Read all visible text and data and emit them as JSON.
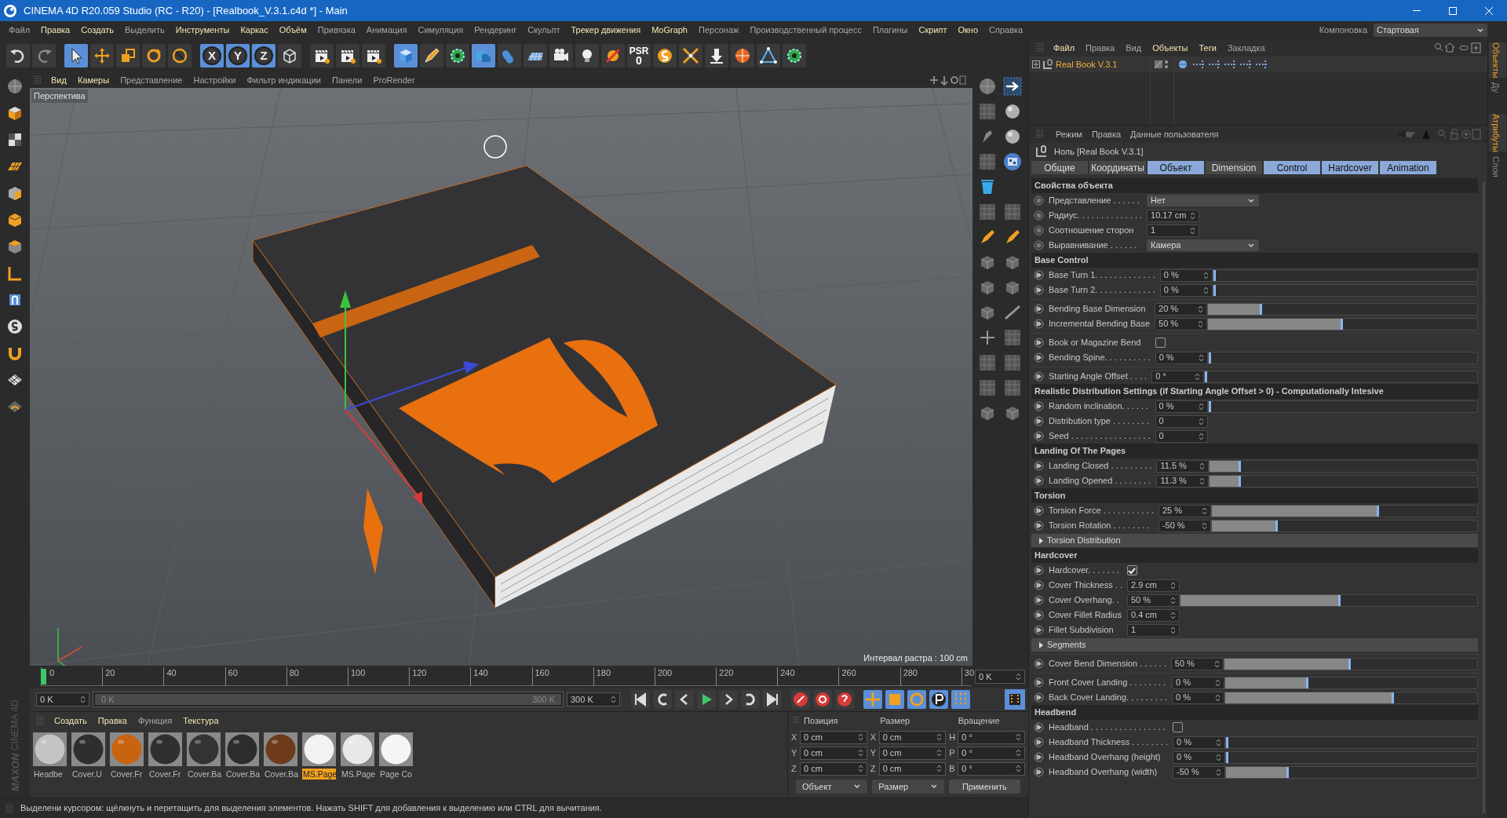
{
  "window": {
    "title": "CINEMA 4D R20.059 Studio (RC - R20) - [Realbook_V.3.1.c4d *] - Main"
  },
  "menu_bar": {
    "items": [
      {
        "label": "Файл",
        "highlighted": false
      },
      {
        "label": "Правка",
        "highlighted": true
      },
      {
        "label": "Создать",
        "highlighted": true
      },
      {
        "label": "Выделить",
        "highlighted": false
      },
      {
        "label": "Инструменты",
        "highlighted": true
      },
      {
        "label": "Каркас",
        "highlighted": true
      },
      {
        "label": "Объём",
        "highlighted": true
      },
      {
        "label": "Привязка",
        "highlighted": false
      },
      {
        "label": "Анимация",
        "highlighted": false
      },
      {
        "label": "Симуляция",
        "highlighted": false
      },
      {
        "label": "Рендеринг",
        "highlighted": false
      },
      {
        "label": "Скульпт",
        "highlighted": false
      },
      {
        "label": "Трекер движения",
        "highlighted": true
      },
      {
        "label": "MoGraph",
        "highlighted": true
      },
      {
        "label": "Персонаж",
        "highlighted": false
      },
      {
        "label": "Производственный процесс",
        "highlighted": false
      },
      {
        "label": "Плагины",
        "highlighted": false
      },
      {
        "label": "Скрипт",
        "highlighted": true
      },
      {
        "label": "Окно",
        "highlighted": true
      },
      {
        "label": "Справка",
        "highlighted": false
      }
    ],
    "layout_label": "Компоновка",
    "layout_value": "Стартовая"
  },
  "toolbar": {
    "tools": [
      {
        "kind": "undo",
        "active": false
      },
      {
        "kind": "redo",
        "active": false
      },
      {
        "kind": "cursor",
        "active": true
      },
      {
        "kind": "move",
        "active": false
      },
      {
        "kind": "scale",
        "active": false
      },
      {
        "kind": "rotate",
        "active": false
      },
      {
        "kind": "target",
        "active": false
      },
      {
        "kind": "axis",
        "label": "X",
        "active": true
      },
      {
        "kind": "axis",
        "label": "Y",
        "active": true
      },
      {
        "kind": "axis",
        "label": "Z",
        "active": true
      },
      {
        "kind": "coord",
        "active": false
      },
      {
        "kind": "clapper",
        "active": false
      },
      {
        "kind": "clapper",
        "active": false
      },
      {
        "kind": "clapper",
        "active": false
      },
      {
        "kind": "cube",
        "active": true
      },
      {
        "kind": "pen",
        "active": false
      },
      {
        "kind": "gear",
        "active": false
      },
      {
        "kind": "deformer",
        "active": true
      },
      {
        "kind": "capsule",
        "active": false
      },
      {
        "kind": "floor",
        "active": false
      },
      {
        "kind": "camera",
        "active": false
      },
      {
        "kind": "bulb",
        "active": false
      },
      {
        "kind": "tag",
        "active": false
      },
      {
        "kind": "psr",
        "label": "PSR",
        "value": "0",
        "active": false
      },
      {
        "kind": "spiral",
        "active": false
      },
      {
        "kind": "arrows",
        "active": false
      },
      {
        "kind": "download",
        "active": false
      },
      {
        "kind": "sphere",
        "active": false
      },
      {
        "kind": "triangle",
        "active": false
      },
      {
        "kind": "gear",
        "active": false
      }
    ]
  },
  "viewport": {
    "menu": [
      {
        "label": "Вид",
        "highlighted": true
      },
      {
        "label": "Камеры",
        "highlighted": true
      },
      {
        "label": "Представление",
        "highlighted": false
      },
      {
        "label": "Настройки",
        "highlighted": false
      },
      {
        "label": "Фильтр индикации",
        "highlighted": false
      },
      {
        "label": "Панели",
        "highlighted": false
      },
      {
        "label": "ProRender",
        "highlighted": false
      }
    ],
    "camera_label": "Перспектива",
    "grid_label": "Интервал растра : 100 cm"
  },
  "timeline": {
    "ticks": [
      "0",
      "20",
      "40",
      "60",
      "80",
      "100",
      "120",
      "140",
      "160",
      "180",
      "200",
      "220",
      "240",
      "260",
      "280",
      "30"
    ],
    "current_frame": "0 K",
    "start": "0 K",
    "range": {
      "start": "0 K",
      "end": "300 K",
      "level": 1
    },
    "end": "300 K"
  },
  "material_manager": {
    "menu": [
      {
        "label": "Создать",
        "highlighted": true
      },
      {
        "label": "Правка",
        "highlighted": true
      },
      {
        "label": "Функция",
        "highlighted": false
      },
      {
        "label": "Текстура",
        "highlighted": true
      }
    ],
    "materials": [
      {
        "name": "Headbe",
        "color": "#c4c4c4",
        "selected": false
      },
      {
        "name": "Cover.U",
        "color": "#2e2e2e",
        "selected": false
      },
      {
        "name": "Cover.Fr",
        "color": "#c8640f",
        "selected": false
      },
      {
        "name": "Cover.Fr",
        "color": "#303030",
        "selected": false
      },
      {
        "name": "Cover.Ba",
        "color": "#333333",
        "selected": false
      },
      {
        "name": "Cover.Ba",
        "color": "#2c2c2c",
        "selected": false
      },
      {
        "name": "Cover.Ba",
        "color": "#6e3a1c",
        "selected": false
      },
      {
        "name": "MS.Page",
        "color": "#f2f2f2",
        "selected": true
      },
      {
        "name": "MS.Page",
        "color": "#e8e8e8",
        "selected": false
      },
      {
        "name": "Page Co",
        "color": "#f5f5f5",
        "selected": false
      }
    ]
  },
  "coordinates": {
    "headers": [
      "Позиция",
      "Размер",
      "Вращение"
    ],
    "rows": [
      {
        "fields": [
          {
            "axis": "X",
            "value": "0 cm"
          },
          {
            "axis": "X",
            "value": "0 cm"
          },
          {
            "axis": "H",
            "value": "0 °"
          }
        ]
      },
      {
        "fields": [
          {
            "axis": "Y",
            "value": "0 cm"
          },
          {
            "axis": "Y",
            "value": "0 cm"
          },
          {
            "axis": "P",
            "value": "0 °"
          }
        ]
      },
      {
        "fields": [
          {
            "axis": "Z",
            "value": "0 cm"
          },
          {
            "axis": "Z",
            "value": "0 cm"
          },
          {
            "axis": "B",
            "value": "0 °"
          }
        ]
      }
    ],
    "dropdowns": [
      "Объект",
      "Размер"
    ],
    "apply_button": "Применить"
  },
  "logo": {
    "lines": [
      "MAXON",
      "CINEMA 4D"
    ]
  },
  "status_bar": "Выделени курсором: щёлкнуть и перетащить для выделения элементов. Нажать SHIFT для добавления к выделению или CTRL для вычитания.",
  "object_manager": {
    "menu": [
      {
        "label": "Файл",
        "highlighted": true
      },
      {
        "label": "Правка",
        "highlighted": false
      },
      {
        "label": "Вид",
        "highlighted": false
      },
      {
        "label": "Объекты",
        "highlighted": true
      },
      {
        "label": "Теги",
        "highlighted": true
      },
      {
        "label": "Закладка",
        "highlighted": false
      }
    ],
    "objects": [
      {
        "name": "Real Book V.3.1"
      }
    ]
  },
  "side_tabs": [
    {
      "label": "Объекты",
      "selected": true
    },
    {
      "label": "Ду",
      "selected": false
    },
    {
      "label": "Атрибуты",
      "selected": true
    },
    {
      "label": "Слои",
      "selected": false
    }
  ],
  "attributes": {
    "menu": [
      "Режим",
      "Правка",
      "Данные пользователя"
    ],
    "object_title": "Ноль [Real Book V.3.1]",
    "tabs": [
      {
        "label": "Общие",
        "selected": false
      },
      {
        "label": "Координаты",
        "selected": false
      },
      {
        "label": "Объект",
        "selected": true
      },
      {
        "label": "Dimension",
        "selected": false
      },
      {
        "label": "Control",
        "selected": true
      },
      {
        "label": "Hardcover",
        "selected": true
      },
      {
        "label": "Animation",
        "selected": true
      }
    ],
    "sections": [
      {
        "title": "Свойства объекта",
        "blocks": [
          [
            {
              "kind": "dropdown",
              "label": "Представление . . . . . .",
              "value": "Нет"
            },
            {
              "kind": "number",
              "label": "Радиус. . . . . . . . . . . . . .",
              "value": "10.17 cm"
            },
            {
              "kind": "number",
              "label": "Соотношение сторон",
              "value": "1"
            },
            {
              "kind": "dropdown",
              "label": "Выравнивание . . . . . .",
              "value": "Камера"
            }
          ]
        ]
      },
      {
        "title": "Base Control",
        "blocks": [
          [
            {
              "kind": "slider",
              "label": "Base Turn 1. . . . . . . . . . . . .",
              "value": "0 %",
              "level": 0
            },
            {
              "kind": "slider",
              "label": "Base Turn 2. . . . . . . . . . . . .",
              "value": "0 %",
              "level": 0
            }
          ],
          [
            {
              "kind": "slider",
              "label": "Bending Base Dimension",
              "value": "20 %",
              "level": 0.2
            },
            {
              "kind": "slider",
              "label": "Incremental Bending Base",
              "value": "50 %",
              "level": 0.5
            }
          ],
          [
            {
              "kind": "checkbox",
              "label": "Book or Magazine Bend",
              "checked": false
            },
            {
              "kind": "slider",
              "label": "Bending Spine. . . . . . . . . .",
              "value": "0 %",
              "level": 0
            }
          ],
          [
            {
              "kind": "slider",
              "label": "Starting Angle Offset . . . .",
              "value": "0 °",
              "level": 0
            }
          ]
        ]
      },
      {
        "title": "Realistic Distribution Settings (if Starting Angle Offset > 0) - Computationally Intesive",
        "blocks": [
          [
            {
              "kind": "slider",
              "label": "Random inclination. . . . . .",
              "value": "0 %",
              "level": 0
            },
            {
              "kind": "number",
              "label": "Distribution type . . . . . . . .",
              "value": "0"
            },
            {
              "kind": "number",
              "label": "Seed . . . . . . . . . . . . . . . . .",
              "value": "0"
            }
          ]
        ]
      },
      {
        "title": "Landing Of The Pages",
        "blocks": [
          [
            {
              "kind": "slider",
              "label": "Landing Closed . . . . . . . . .",
              "value": "11.5 %",
              "level": 0.115
            },
            {
              "kind": "slider",
              "label": "Landing Opened . . . . . . . .",
              "value": "11.3 %",
              "level": 0.115
            }
          ]
        ]
      },
      {
        "title": "Torsion",
        "blocks": [
          [
            {
              "kind": "slider",
              "label": "Torsion Force . . . . . . . . . . .",
              "value": "25 %",
              "level": 0.63
            },
            {
              "kind": "slider",
              "label": "Torsion Rotation . . . . . . . .",
              "value": "-50 %",
              "level": 0.25
            },
            {
              "kind": "group",
              "label": "Torsion Distribution",
              "expanded": false
            }
          ]
        ]
      },
      {
        "title": "Hardcover",
        "blocks": [
          [
            {
              "kind": "checkbox",
              "label": "Hardcover. . . . . . .",
              "checked": true
            },
            {
              "kind": "number",
              "label": "Cover Thickness . .",
              "value": "2.9 cm"
            },
            {
              "kind": "slider",
              "label": "Cover Overhang. .",
              "value": "50 %",
              "level": 0.54
            },
            {
              "kind": "number",
              "label": "Cover Fillet Radius",
              "value": "0.4 cm"
            },
            {
              "kind": "number",
              "label": "Fillet Subdivision",
              "value": "1"
            },
            {
              "kind": "group",
              "label": "Segments",
              "expanded": false
            }
          ],
          [
            {
              "kind": "slider",
              "label": "Cover Bend Dimension . . . . . .",
              "value": "50 %",
              "level": 0.5
            }
          ],
          [
            {
              "kind": "slider",
              "label": "Front Cover Landing . . . . . . . .",
              "value": "0 %",
              "level": 0.33
            },
            {
              "kind": "slider",
              "label": "Back Cover Landing. . . . . . . . .",
              "value": "0 %",
              "level": 0.67
            }
          ]
        ]
      },
      {
        "title": "Headbend",
        "blocks": [
          [
            {
              "kind": "checkbox",
              "label": "Headband . . . . . . . . . . . . . . . .",
              "checked": false
            },
            {
              "kind": "slider",
              "label": "Headband Thickness . . . . . . . .",
              "value": "0 %",
              "level": 0
            },
            {
              "kind": "slider",
              "label": "Headband Overhang (height)",
              "value": "0 %",
              "level": 0
            },
            {
              "kind": "slider",
              "label": "Headband Overhang (width)",
              "value": "-50 %",
              "level": 0.25
            }
          ]
        ]
      }
    ]
  }
}
